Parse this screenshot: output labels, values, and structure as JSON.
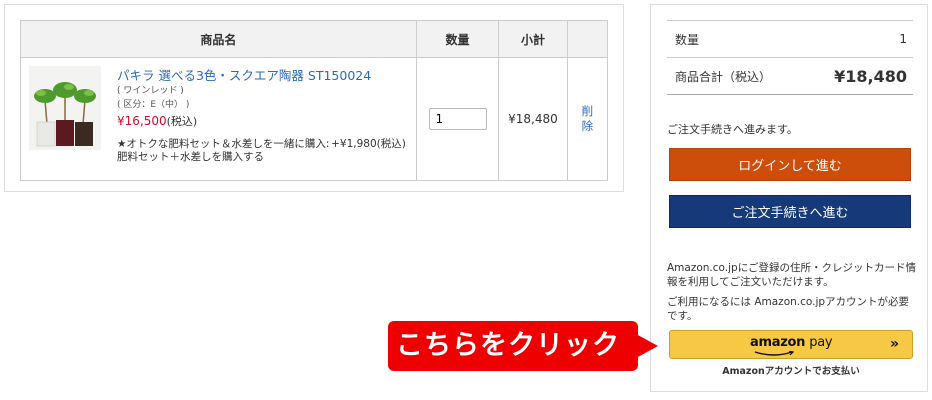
{
  "cart": {
    "headers": {
      "name": "商品名",
      "qty": "数量",
      "subtotal": "小計"
    },
    "item": {
      "name": "パキラ 選べる3色・スクエア陶器 ST150024",
      "color_variant": "( ワインレッド )",
      "size_variant": "( 区分：E（中） )",
      "price": "¥16,500",
      "tax_label": "(税込)",
      "option_text": "★オトクな肥料セット＆水差しを一緒に購入:",
      "option_price": "+¥1,980(税込)",
      "option_selected": "肥料セット＋水差しを購入する",
      "quantity": "1",
      "subtotal": "¥18,480",
      "delete_label": "削除"
    }
  },
  "summary": {
    "qty_label": "数量",
    "qty_value": "1",
    "total_label": "商品合計（税込）",
    "total_value": "¥18,480",
    "proceed_text": "ご注文手続きへ進みます。",
    "login_button": "ログインして進む",
    "order_button": "ご注文手続きへ進む",
    "amazon_desc_1": "Amazon.co.jpにご登録の住所・クレジットカード情報を利用してご注文いただけます。",
    "amazon_desc_2": "ご利用になるには Amazon.co.jpアカウントが必要です。",
    "amazon_pay_word_1": "amazon",
    "amazon_pay_word_2": "pay",
    "amazon_pay_chevron": "»",
    "amazon_caption": "Amazonアカウントでお支払い"
  },
  "callout": {
    "text": "こちらをクリック"
  },
  "colors": {
    "login": "#cc4e0a",
    "order": "#16397a",
    "amazon": "#f7c843",
    "callout": "#ee0000",
    "price": "#c8102e",
    "link": "#2a6ab5"
  }
}
